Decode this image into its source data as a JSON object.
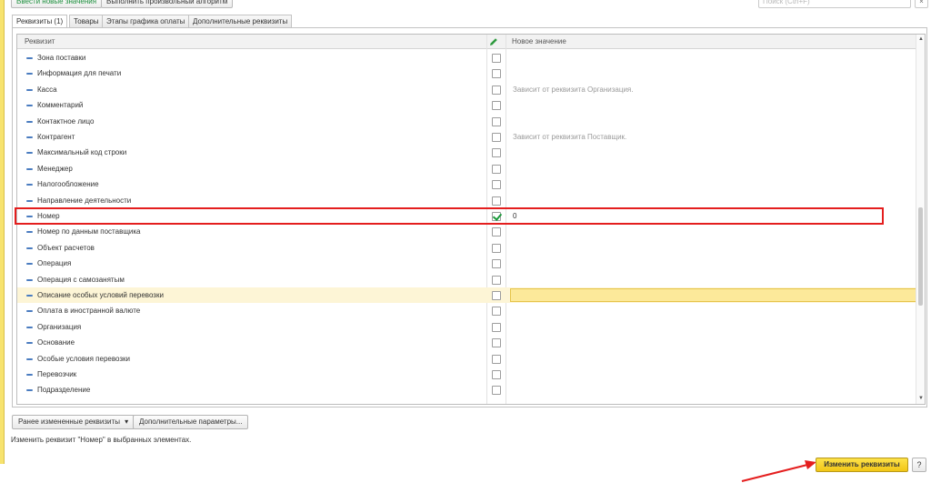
{
  "toolbar": {
    "enter_new_values": "Ввести новые значения",
    "run_algorithm": "Выполнить произвольный алгоритм",
    "search_placeholder": "Поиск (Ctrl+F)",
    "search_clear": "×"
  },
  "tabs": [
    {
      "label": "Реквизиты (1)",
      "active": true
    },
    {
      "label": "Товары",
      "active": false
    },
    {
      "label": "Этапы графика оплаты",
      "active": false
    },
    {
      "label": "Дополнительные реквизиты",
      "active": false
    }
  ],
  "grid": {
    "col_attribute": "Реквизит",
    "col_new_value": "Новое значение",
    "rows": [
      {
        "name": "Зона поставки",
        "checked": false,
        "value": ""
      },
      {
        "name": "Информация для печати",
        "checked": false,
        "value": ""
      },
      {
        "name": "Касса",
        "checked": false,
        "value": "Зависит от реквизита Организация."
      },
      {
        "name": "Комментарий",
        "checked": false,
        "value": ""
      },
      {
        "name": "Контактное лицо",
        "checked": false,
        "value": ""
      },
      {
        "name": "Контрагент",
        "checked": false,
        "value": "Зависит от реквизита Поставщик."
      },
      {
        "name": "Максимальный код строки",
        "checked": false,
        "value": ""
      },
      {
        "name": "Менеджер",
        "checked": false,
        "value": ""
      },
      {
        "name": "Налогообложение",
        "checked": false,
        "value": ""
      },
      {
        "name": "Направление деятельности",
        "checked": false,
        "value": ""
      },
      {
        "name": "Номер",
        "checked": true,
        "value": "0"
      },
      {
        "name": "Номер по данным поставщика",
        "checked": false,
        "value": ""
      },
      {
        "name": "Объект расчетов",
        "checked": false,
        "value": ""
      },
      {
        "name": "Операция",
        "checked": false,
        "value": ""
      },
      {
        "name": "Операция с самозанятым",
        "checked": false,
        "value": ""
      },
      {
        "name": "Описание особых условий перевозки",
        "checked": false,
        "value": "",
        "selected": true
      },
      {
        "name": "Оплата в иностранной валюте",
        "checked": false,
        "value": ""
      },
      {
        "name": "Организация",
        "checked": false,
        "value": ""
      },
      {
        "name": "Основание",
        "checked": false,
        "value": ""
      },
      {
        "name": "Особые условия перевозки",
        "checked": false,
        "value": ""
      },
      {
        "name": "Перевозчик",
        "checked": false,
        "value": ""
      },
      {
        "name": "Подразделение",
        "checked": false,
        "value": ""
      }
    ]
  },
  "bottom": {
    "previously_changed": "Ранее измененные реквизиты",
    "dropdown_glyph": "▾",
    "additional_params": "Дополнительные параметры...",
    "hint": "Изменить реквизит \"Номер\" в выбранных элементах.",
    "apply": "Изменить реквизиты",
    "help": "?"
  },
  "colors": {
    "accent_yellow": "#f2c616",
    "highlight_red": "#e41e1e",
    "check_green": "#1b9a3b",
    "selected_row": "#fdf5d6"
  }
}
